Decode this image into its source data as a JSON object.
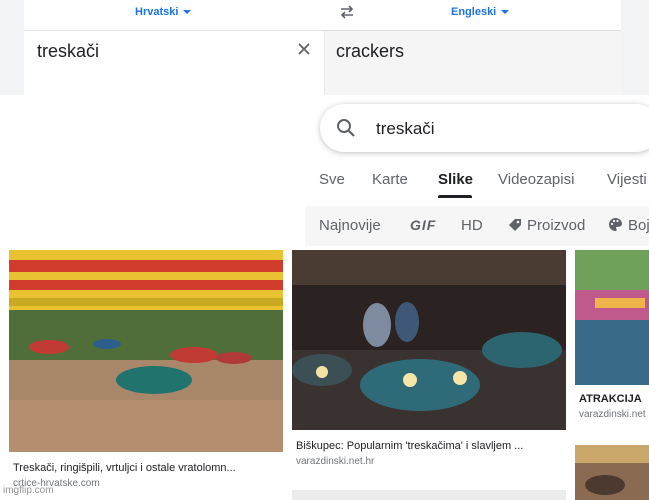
{
  "translate": {
    "source_lang": "Hrvatski",
    "target_lang": "Engleski",
    "source_text": "treskači",
    "target_text": "crackers"
  },
  "search": {
    "query": "treskači"
  },
  "tabs": [
    {
      "label": "Sve"
    },
    {
      "label": "Karte"
    },
    {
      "label": "Slike",
      "active": true
    },
    {
      "label": "Videozapisi"
    },
    {
      "label": "Vijesti"
    }
  ],
  "filters": [
    {
      "label": "Najnovije"
    },
    {
      "label": "GIF"
    },
    {
      "label": "HD"
    },
    {
      "label": "Proizvod",
      "icon": "tag-icon"
    },
    {
      "label": "Boja",
      "icon": "palette-icon"
    }
  ],
  "results": [
    {
      "title": "Treskači, ringišpili, vrtuljci i ostale vratolomn...",
      "source": "crtice-hrvatske.com"
    },
    {
      "title": "Biškupec: Popularnim 'treskačima' i slavljem ...",
      "source": "varazdinski.net.hr"
    },
    {
      "title": "ATRAKCIJA",
      "source": "varazdinski.net"
    }
  ],
  "watermark": "imgflip.com",
  "colors": {
    "link_blue": "#1a73e8",
    "text_dark": "#202124",
    "text_gray": "#5f6368"
  }
}
